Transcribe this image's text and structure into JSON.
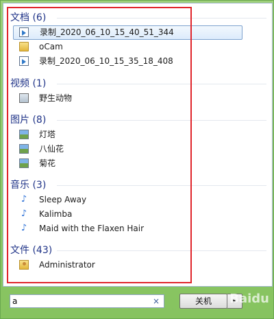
{
  "groups": [
    {
      "header": "文档 (6)",
      "items": [
        {
          "label": "录制_2020_06_10_15_40_51_344",
          "icon": "video-file-icon",
          "selected": true
        },
        {
          "label": "oCam",
          "icon": "folder-icon"
        },
        {
          "label": "录制_2020_06_10_15_35_18_408",
          "icon": "video-file-icon"
        }
      ]
    },
    {
      "header": "视频 (1)",
      "items": [
        {
          "label": "野生动物",
          "icon": "media-file-icon"
        }
      ]
    },
    {
      "header": "图片 (8)",
      "items": [
        {
          "label": "灯塔",
          "icon": "image-file-icon"
        },
        {
          "label": "八仙花",
          "icon": "image-file-icon"
        },
        {
          "label": "菊花",
          "icon": "image-file-icon"
        }
      ]
    },
    {
      "header": "音乐 (3)",
      "items": [
        {
          "label": "Sleep Away",
          "icon": "music-note-icon"
        },
        {
          "label": "Kalimba",
          "icon": "music-note-icon"
        },
        {
          "label": "Maid with the Flaxen Hair",
          "icon": "music-note-icon"
        }
      ]
    },
    {
      "header": "文件 (43)",
      "items": [
        {
          "label": "Administrator",
          "icon": "user-folder-icon"
        }
      ]
    }
  ],
  "search": {
    "value": "a",
    "clear": "×"
  },
  "shutdown": {
    "label": "关机",
    "arrow": "▸"
  },
  "watermark": "Baidu"
}
